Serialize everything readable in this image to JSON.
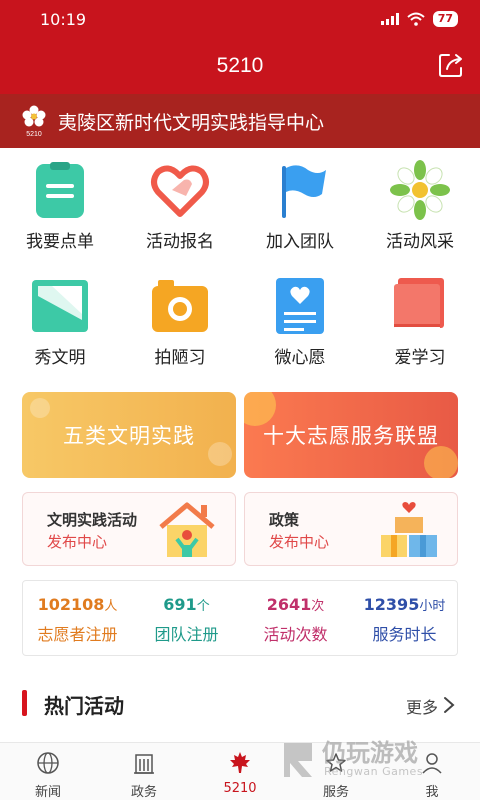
{
  "status": {
    "time": "10:19",
    "battery": "77"
  },
  "header": {
    "title": "5210"
  },
  "banner": {
    "logo_text": "5210",
    "text": "夷陵区新时代文明实践指导中心"
  },
  "grid": [
    {
      "label": "我要点单",
      "icon": "clipboard-icon",
      "color": "#3dc9a6"
    },
    {
      "label": "活动报名",
      "icon": "heart-hand-icon",
      "color": "#f05a4a"
    },
    {
      "label": "加入团队",
      "icon": "flag-icon",
      "color": "#3a9ff0"
    },
    {
      "label": "活动风采",
      "icon": "flower-icon",
      "color": "#7cc24b"
    },
    {
      "label": "秀文明",
      "icon": "picture-icon",
      "color": "#3dc9a6"
    },
    {
      "label": "拍陋习",
      "icon": "camera-icon",
      "color": "#f5a623"
    },
    {
      "label": "微心愿",
      "icon": "wish-card-icon",
      "color": "#3a9ff0"
    },
    {
      "label": "爱学习",
      "icon": "book-icon",
      "color": "#ee5a4e"
    }
  ],
  "big_cards": [
    {
      "label": "五类文明实践"
    },
    {
      "label": "十大志愿服务联盟"
    }
  ],
  "mid_cards": [
    {
      "title": "文明实践活动",
      "subtitle": "发布中心"
    },
    {
      "title": "政策",
      "subtitle": "发布中心"
    }
  ],
  "stats": [
    {
      "value": "102108",
      "unit": "人",
      "label": "志愿者注册",
      "color": "#e07b1f"
    },
    {
      "value": "691",
      "unit": "个",
      "label": "团队注册",
      "color": "#1f9a8a"
    },
    {
      "value": "2641",
      "unit": "次",
      "label": "活动次数",
      "color": "#c0306a"
    },
    {
      "value": "12395",
      "unit": "小时",
      "label": "服务时长",
      "color": "#2f4fa8"
    }
  ],
  "section": {
    "title": "热门活动",
    "more": "更多"
  },
  "tabs": [
    {
      "label": "新闻",
      "icon": "globe-icon"
    },
    {
      "label": "政务",
      "icon": "building-icon"
    },
    {
      "label": "5210",
      "icon": "maple-leaf-icon"
    },
    {
      "label": "服务",
      "icon": "service-icon"
    },
    {
      "label": "我",
      "icon": "person-icon"
    }
  ],
  "watermark": {
    "title": "仍玩游戏",
    "subtitle": "Rengwan Games"
  },
  "colors": {
    "primary": "#c8141d",
    "banner": "#a8231f"
  }
}
